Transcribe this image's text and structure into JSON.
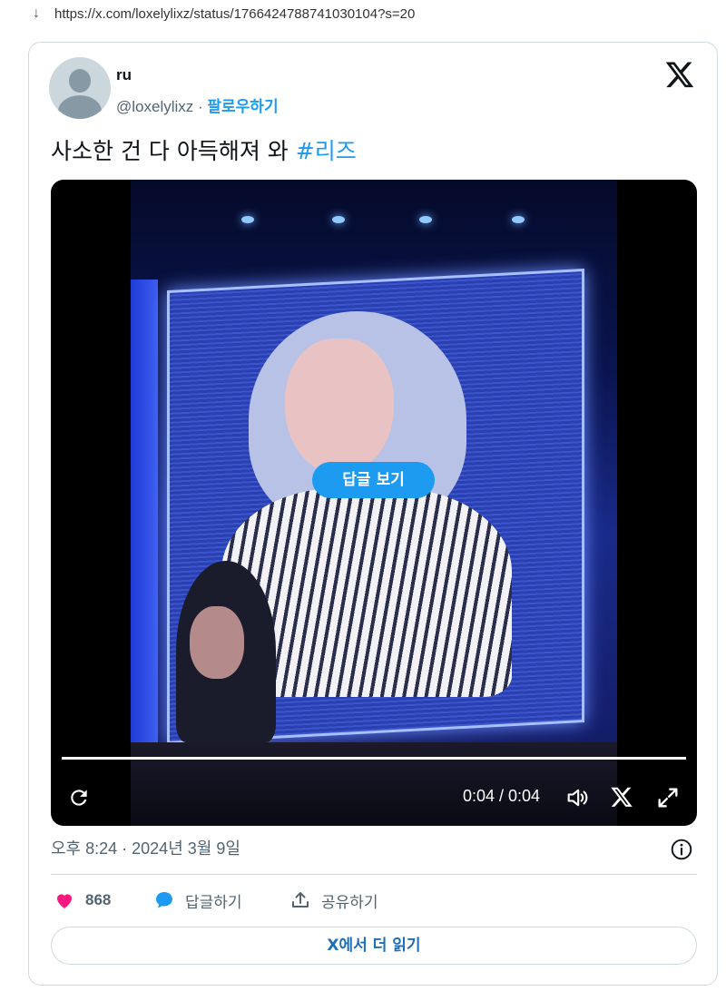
{
  "browser": {
    "download_arrow": "↓",
    "url": "https://x.com/loxelylixz/status/1766424788741030104?s=20"
  },
  "tweet": {
    "author": {
      "name": "ru",
      "handle": "@loxelylixz",
      "separator": " · ",
      "follow_label": "팔로우하기"
    },
    "text": "사소한 건 다 아득해져 와 ",
    "hashtag": "#리즈",
    "video": {
      "reply_pill": "답글 보기",
      "time": "0:04 / 0:04",
      "progress_fraction": 1.0
    },
    "timestamp": "오후 8:24 · 2024년 3월 9일",
    "actions": {
      "likes": "868",
      "reply_label": "답글하기",
      "share_label": "공유하기"
    },
    "read_more": "X에서 더 읽기"
  },
  "colors": {
    "accent": "#1d9bf0",
    "heart": "#f91880",
    "muted": "#536471",
    "border": "#cfd9de"
  }
}
